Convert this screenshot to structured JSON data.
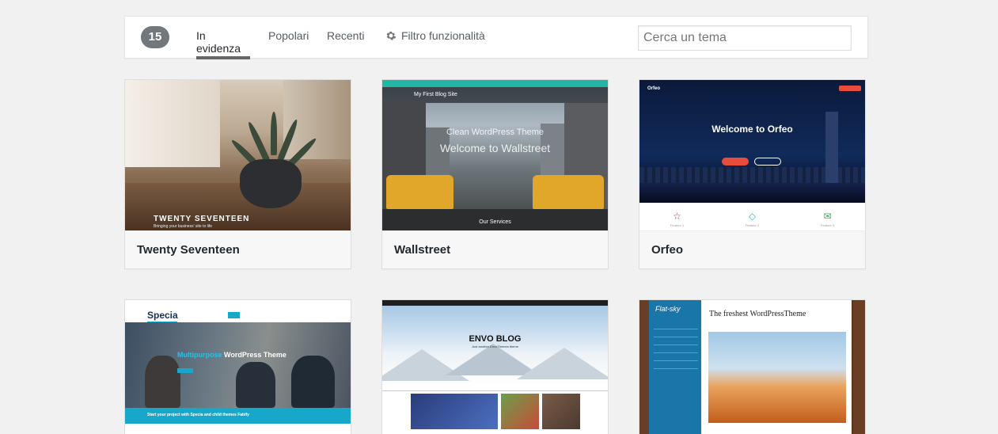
{
  "filter_bar": {
    "count": "15",
    "tabs": [
      {
        "label": "In evidenza"
      },
      {
        "label": "Popolari"
      },
      {
        "label": "Recenti"
      },
      {
        "label": "Filtro funzionalità"
      }
    ],
    "search_placeholder": "Cerca un tema"
  },
  "themes": [
    {
      "name": "Twenty Seventeen",
      "screenshot_text": "TWENTY SEVENTEEN",
      "screenshot_subtext": "Bringing your business' site to life"
    },
    {
      "name": "Wallstreet",
      "nav_title": "My First Blog Site",
      "headline1": "Clean WordPress Theme",
      "headline2": "Welcome to Wallstreet",
      "services": "Our Services"
    },
    {
      "name": "Orfeo",
      "nav_title": "Orfeo",
      "welcome": "Welcome to Orfeo",
      "features": [
        "Feature 1",
        "Feature 2",
        "Feature 3"
      ]
    },
    {
      "name": "Specia",
      "logo": "Specia",
      "hero": "Multipurpose",
      "hero_suffix": " WordPress Theme",
      "cta": "Start your project with Specia and child themes Fabify"
    },
    {
      "name": "Envo Blog",
      "title": "ENVO BLOG",
      "subtitle": "Just another EnvoThemes theme"
    },
    {
      "name": "Flat-sky",
      "sidebar_title": "Flat-sky",
      "post_title": "The freshest WordPressTheme"
    }
  ],
  "colors": {
    "count_badge": "#72777c",
    "wallstreet_accent": "#22b7a5",
    "specia_accent": "#17a7c8",
    "orfeo_button": "#e74c3c",
    "flatsky_sidebar": "#1a75a8"
  }
}
